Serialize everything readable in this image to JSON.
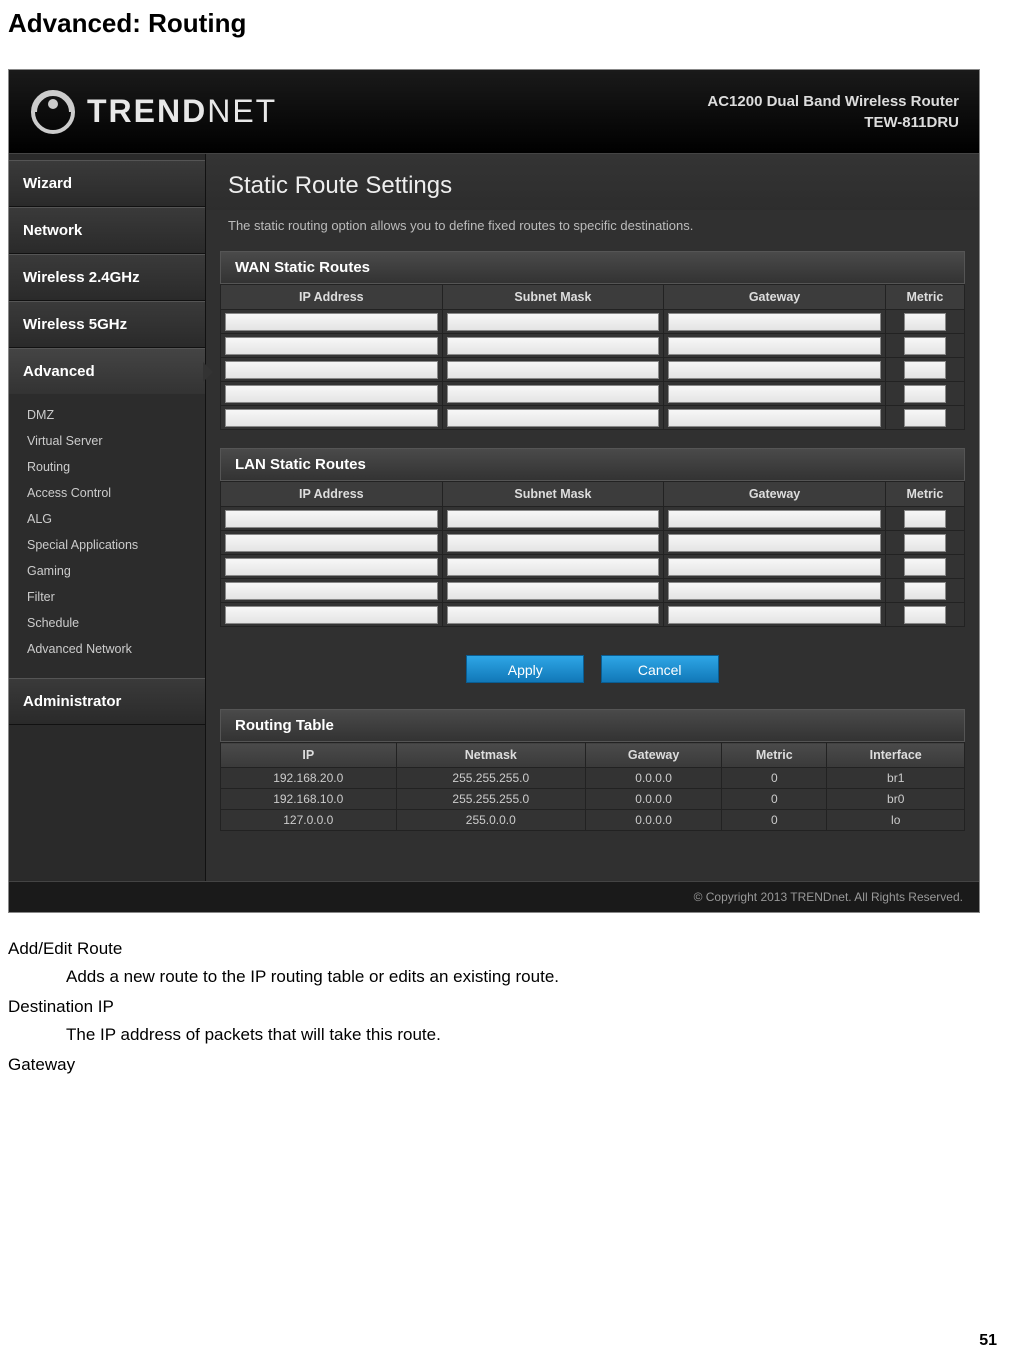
{
  "doc": {
    "title": "Advanced: Routing",
    "page_number": "51",
    "definitions": [
      {
        "term": "Add/Edit Route",
        "def": "Adds a new route to the IP routing table or edits an existing route."
      },
      {
        "term": "Destination IP",
        "def": "The IP address of packets that will take this route."
      },
      {
        "term": "Gateway",
        "def": ""
      }
    ]
  },
  "header": {
    "brand": "TRENDNET",
    "product_line1": "AC1200 Dual Band Wireless Router",
    "product_line2": "TEW-811DRU"
  },
  "sidebar": {
    "items": [
      {
        "label": "Wizard",
        "active": false
      },
      {
        "label": "Network",
        "active": false
      },
      {
        "label": "Wireless 2.4GHz",
        "active": false
      },
      {
        "label": "Wireless 5GHz",
        "active": false
      },
      {
        "label": "Advanced",
        "active": true,
        "subs": [
          "DMZ",
          "Virtual Server",
          "Routing",
          "Access Control",
          "ALG",
          "Special Applications",
          "Gaming",
          "Filter",
          "Schedule",
          "Advanced Network"
        ]
      },
      {
        "label": "Administrator",
        "active": false
      }
    ]
  },
  "panel": {
    "title": "Static Route Settings",
    "desc": "The static routing option allows you to define fixed routes to specific destinations.",
    "wan_section": "WAN Static Routes",
    "lan_section": "LAN Static Routes",
    "cols": {
      "ip": "IP Address",
      "mask": "Subnet Mask",
      "gw": "Gateway",
      "metric": "Metric"
    },
    "wan_rows": 5,
    "lan_rows": 5,
    "buttons": {
      "apply": "Apply",
      "cancel": "Cancel"
    },
    "routing_table_title": "Routing Table",
    "rt_cols": [
      "IP",
      "Netmask",
      "Gateway",
      "Metric",
      "Interface"
    ],
    "rt_rows": [
      {
        "ip": "192.168.20.0",
        "netmask": "255.255.255.0",
        "gateway": "0.0.0.0",
        "metric": "0",
        "iface": "br1"
      },
      {
        "ip": "192.168.10.0",
        "netmask": "255.255.255.0",
        "gateway": "0.0.0.0",
        "metric": "0",
        "iface": "br0"
      },
      {
        "ip": "127.0.0.0",
        "netmask": "255.0.0.0",
        "gateway": "0.0.0.0",
        "metric": "0",
        "iface": "lo"
      }
    ]
  },
  "footer": "© Copyright 2013 TRENDnet. All Rights Reserved."
}
